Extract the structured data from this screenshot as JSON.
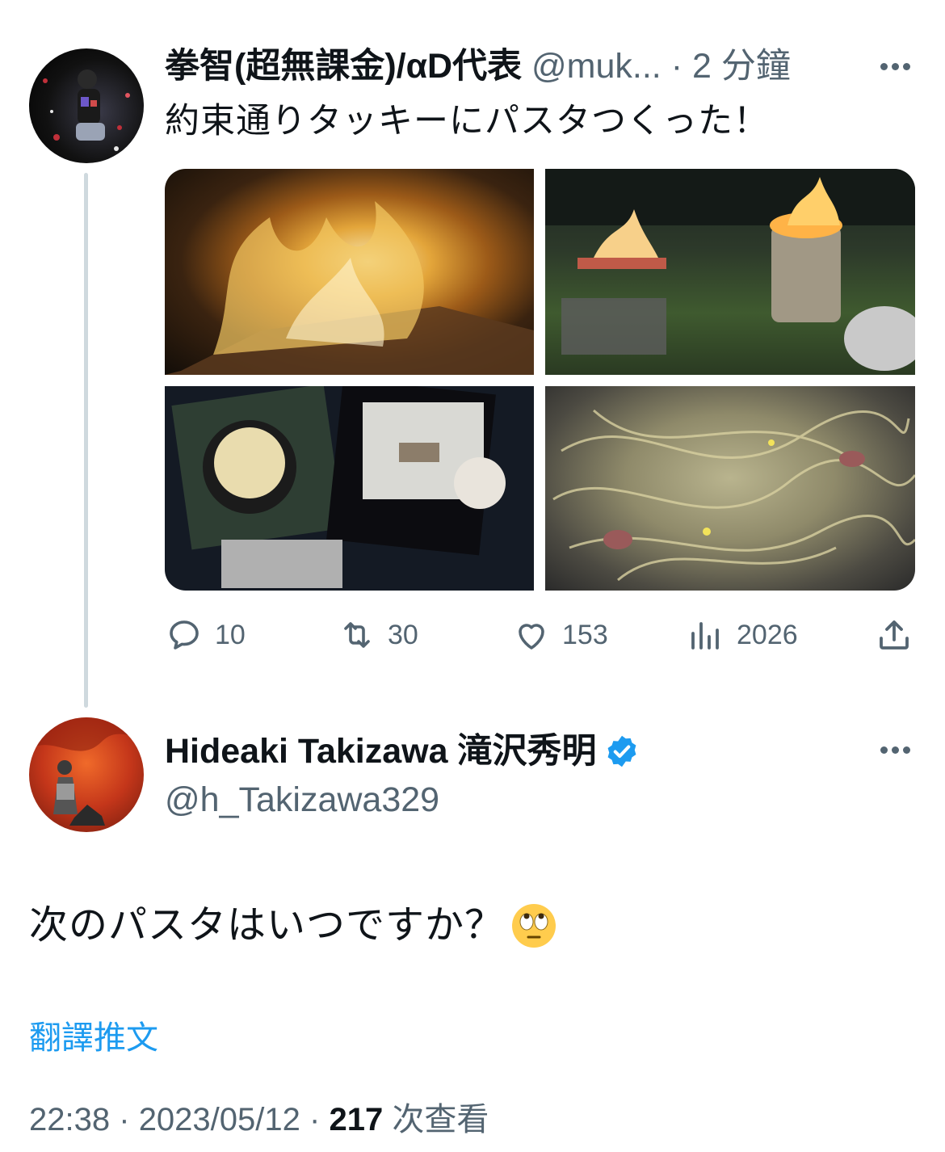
{
  "colors": {
    "text_primary": "#0f1419",
    "text_secondary": "#536471",
    "link": "#1d9bf0",
    "verified": "#1d9bf0",
    "thread_line": "#cfd9de"
  },
  "parent_tweet": {
    "author_name": "拳智(超無課金)/αD代表",
    "handle": "@muk...",
    "separator": "·",
    "time_ago": "2 分鐘",
    "more_icon": "more-horizontal-icon",
    "text": "約束通りタッキーにパスタつくった！",
    "media": [
      {
        "icon": "image-campfire"
      },
      {
        "icon": "image-camp-fire-pit"
      },
      {
        "icon": "image-cooking-collage"
      },
      {
        "icon": "image-pasta-closeup"
      }
    ],
    "actions": {
      "replies": "10",
      "retweets": "30",
      "likes": "153",
      "views": "2026",
      "share_icon": "share-icon"
    }
  },
  "focused_tweet": {
    "author_name": "Hideaki Takizawa 滝沢秀明",
    "verified_icon": "verified-badge-icon",
    "handle": "@h_Takizawa329",
    "more_icon": "more-horizontal-icon",
    "text": "次のパスタはいつですか？",
    "emoji_icon": "face-with-rolling-eyes-emoji",
    "translate_label": "翻譯推文",
    "time": "22:38",
    "date": "2023/05/12",
    "views_count": "217",
    "views_label": "次查看",
    "meta_separator": "·"
  }
}
